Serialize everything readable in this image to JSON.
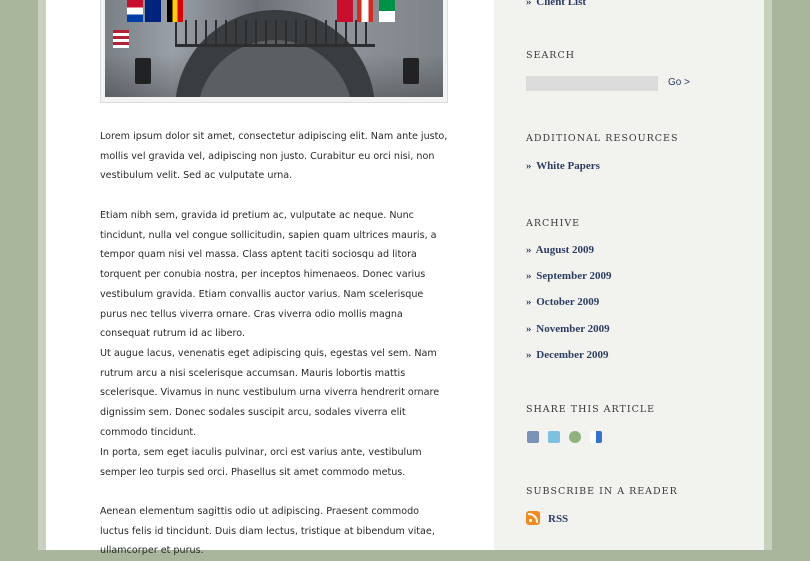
{
  "sidebar": {
    "top_link": "Client List",
    "search": {
      "heading": "Search",
      "placeholder": "",
      "go_label": "Go >"
    },
    "resources": {
      "heading": "Additional Resources",
      "items": [
        "White Papers"
      ]
    },
    "archive": {
      "heading": "Archive",
      "items": [
        "August 2009",
        "September 2009",
        "October 2009",
        "November 2009",
        "December 2009"
      ]
    },
    "share": {
      "heading": "Share This Article",
      "icons": [
        "facebook-icon",
        "twitter-icon",
        "stumbleupon-icon",
        "delicious-icon"
      ]
    },
    "subscribe": {
      "heading": "Subscribe in a Reader",
      "rss_label": "RSS"
    }
  },
  "article": {
    "paragraphs": [
      "Lorem ipsum dolor sit amet, consectetur adipiscing elit. Nam ante justo, mollis vel gravida vel, adipiscing non justo. Curabitur eu orci nisi, non vestibulum velit. Sed ac vulputate urna.",
      "Etiam nibh sem, gravida id pretium ac, vulputate ac neque. Nunc tincidunt, nulla vel congue sollicitudin, sapien quam ultrices mauris, a tempor quam nisi vel massa. Class aptent taciti sociosqu ad litora torquent per conubia nostra, per inceptos himenaeos. Donec varius vestibulum gravida. Etiam convallis auctor varius. Nam scelerisque purus nec tellus viverra ornare. Cras viverra odio mollis magna consequat rutrum id ac libero.",
      "Ut augue lacus, venenatis eget adipiscing quis, egestas vel sem. Nam rutrum arcu a nisi scelerisque accumsan. Mauris lobortis mattis scelerisque. Vivamus in nunc vestibulum urna viverra hendrerit ornare dignissim sem. Donec sodales suscipit arcu, sodales viverra elit commodo tincidunt.",
      "In porta, sem eget iaculis pulvinar, orci est varius ante, vestibulum semper leo turpis sed orci. Phasellus sit amet commodo metus.",
      "Aenean elementum sagittis odio ut adipiscing. Praesent commodo luctus felis id tincidunt. Duis diam lectus, tristique at bibendum vitae, ullamcorper et purus."
    ]
  },
  "colors": {
    "link": "#2c3f63",
    "rss": "#f28a1e",
    "sidebar_bg": "#f2f2ef",
    "page_bg": "#a9b69c"
  }
}
